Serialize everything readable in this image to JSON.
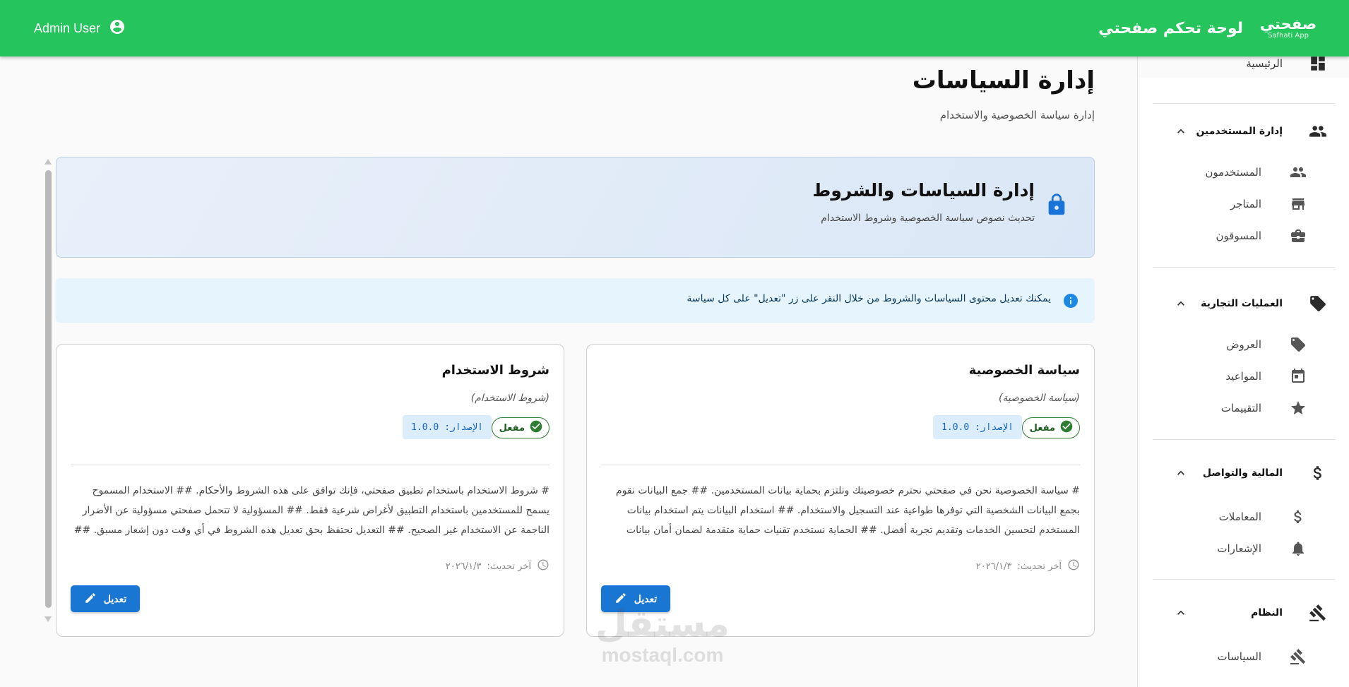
{
  "header": {
    "user_name": "Admin User",
    "brand_logo_text": "صفحتي",
    "brand_logo_sub": "Safhati App",
    "title": "لوحة تحكم صفحتي",
    "bar_color": "#25c45c"
  },
  "sidebar": {
    "home": {
      "label": "الرئيسية",
      "icon": "dashboard-icon"
    },
    "groups": [
      {
        "label": "إدارة المستخدمين",
        "icon": "people-icon",
        "items": [
          {
            "label": "المستخدمون",
            "icon": "people-icon"
          },
          {
            "label": "المتاجر",
            "icon": "store-icon"
          },
          {
            "label": "المسوقون",
            "icon": "briefcase-icon"
          }
        ]
      },
      {
        "label": "العمليات التجارية",
        "icon": "tag-icon",
        "items": [
          {
            "label": "العروض",
            "icon": "tag-icon"
          },
          {
            "label": "المواعيد",
            "icon": "calendar-icon"
          },
          {
            "label": "التقييمات",
            "icon": "star-icon"
          }
        ]
      },
      {
        "label": "المالية والتواصل",
        "icon": "dollar-icon",
        "items": [
          {
            "label": "المعاملات",
            "icon": "dollar-icon"
          },
          {
            "label": "الإشعارات",
            "icon": "bell-icon"
          }
        ]
      },
      {
        "label": "النظام",
        "icon": "gavel-icon",
        "items": [
          {
            "label": "السياسات",
            "icon": "gavel-icon"
          }
        ]
      }
    ]
  },
  "page": {
    "title": "إدارة السياسات",
    "subtitle": "إدارة سياسة الخصوصية والاستخدام"
  },
  "hero": {
    "title": "إدارة السياسات والشروط",
    "description": "تحديث نصوص سياسة الخصوصية وشروط الاستخدام",
    "icon": "lock-icon"
  },
  "info": {
    "text": "يمكنك تعديل محتوى السياسات والشروط من خلال النقر على زر \"تعديل\" على كل سياسة",
    "icon": "info-icon"
  },
  "cards": [
    {
      "title": "سياسة الخصوصية",
      "subtitle": "(سياسة الخصوصية)",
      "status": "مفعل",
      "version_label": "الإصدار:",
      "version": "1.0.0",
      "body": "# سياسة الخصوصية نحن في صفحتي نحترم خصوصيتك ونلتزم بحماية بيانات المستخدمين. ## جمع البيانات نقوم بجمع البيانات الشخصية التي توفرها طواعية عند التسجيل والاستخدام. ## استخدام البيانات يتم استخدام بيانات المستخدم لتحسين الخدمات وتقديم تجربة أفضل. ## الحماية نستخدم تقنيات حماية متقدمة لضمان أمان بيانات المستخدمين. ## المزيد من...",
      "updated_label": "آخر تحديث:",
      "updated": "٢٠٢٦/١/٣",
      "edit_label": "تعديل"
    },
    {
      "title": "شروط الاستخدام",
      "subtitle": "(شروط الاستخدام)",
      "status": "مفعل",
      "version_label": "الإصدار:",
      "version": "1.0.0",
      "body": "# شروط الاستخدام باستخدام تطبيق صفحتي، فإنك توافق على هذه الشروط والأحكام. ## الاستخدام المسموح يسمح للمستخدمين باستخدام التطبيق لأغراض شرعية فقط. ## المسؤولية لا تتحمل صفحتي مسؤولية عن الأضرار الناجمة عن الاستخدام غير الصحيح. ## التعديل نحتفظ بحق تعديل هذه الشروط في أي وقت دون إشعار مسبق. ## الإنهاء قد نقوم...",
      "updated_label": "آخر تحديث:",
      "updated": "٢٠٢٦/١/٣",
      "edit_label": "تعديل"
    }
  ],
  "watermark": {
    "ar": "مستقل",
    "en": "mostaql.com"
  }
}
